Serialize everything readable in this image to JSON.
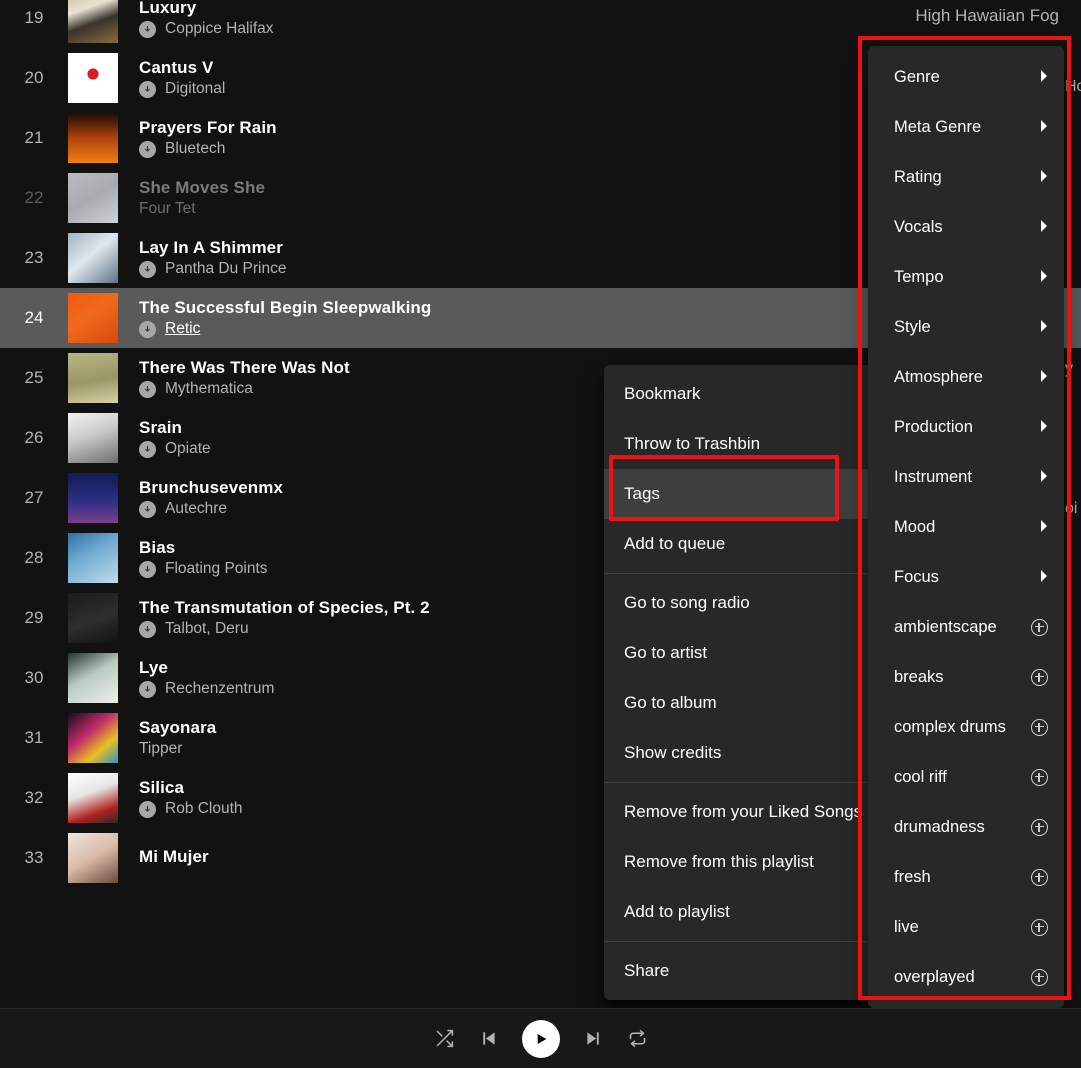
{
  "app": {
    "right_label": "High Hawaiian Fog",
    "edge_fragments": [
      "Ho",
      "y",
      "oi"
    ]
  },
  "tracklist": {
    "rows": [
      {
        "index": "19",
        "title": "Luxury",
        "artist": "Coppice Halifax",
        "downloaded": true,
        "dimmed": false,
        "art": "linear-gradient(160deg,#cbbfa8 0%,#e8e2d4 32%,#3a332a 58%,#8a6a41 100%)"
      },
      {
        "index": "20",
        "title": "Cantus V",
        "artist": "Digitonal",
        "downloaded": true,
        "dimmed": false,
        "art": "radial-gradient(circle at 50% 42%, #d81f26 0 14%, #ffffff 15% 100%)"
      },
      {
        "index": "21",
        "title": "Prayers For Rain",
        "artist": "Bluetech",
        "downloaded": true,
        "dimmed": false,
        "art": "linear-gradient(180deg,#1d0c05 0%,#b3450c 52%,#f07e14 100%)"
      },
      {
        "index": "22",
        "title": "She Moves She",
        "artist": "Four Tet",
        "downloaded": false,
        "dimmed": true,
        "art": "linear-gradient(150deg,#b9bcc0 0%,#a7aaae 50%,#cfd2d6 100%)"
      },
      {
        "index": "23",
        "title": "Lay In A Shimmer",
        "artist": "Pantha Du Prince",
        "downloaded": true,
        "dimmed": false,
        "art": "linear-gradient(140deg,#9fb4c4 0%,#dfe7ee 45%,#5d7487 100%)"
      },
      {
        "index": "24",
        "title": "The Successful Begin Sleepwalking",
        "artist": "Retic",
        "downloaded": true,
        "dimmed": false,
        "selected": true,
        "art": "linear-gradient(145deg,#f25a10 0%,#ef6a1d 45%,#d8490a 100%)"
      },
      {
        "index": "25",
        "title": "There Was There Was Not",
        "artist": "Mythematica",
        "downloaded": true,
        "dimmed": false,
        "art": "linear-gradient(170deg,#b9b684 0%,#9a9668 55%,#d7d2a6 100%)"
      },
      {
        "index": "26",
        "title": "Srain",
        "artist": "Opiate",
        "downloaded": true,
        "dimmed": false,
        "art": "linear-gradient(160deg,#f2f2f2 0%,#c9c9c9 45%,#6d6d6d 100%)"
      },
      {
        "index": "27",
        "title": "Brunchusevenmx",
        "artist": "Autechre",
        "downloaded": true,
        "dimmed": false,
        "art": "linear-gradient(180deg,#141a52 0%,#2b2f86 55%,#7a3f8c 100%)"
      },
      {
        "index": "28",
        "title": "Bias",
        "artist": "Floating Points",
        "downloaded": true,
        "dimmed": false,
        "art": "linear-gradient(150deg,#2f6fa8 0%,#6fa8cf 40%,#bfdcee 100%)"
      },
      {
        "index": "29",
        "title": "The Transmutation of Species, Pt. 2",
        "artist": "Talbot, Deru",
        "downloaded": true,
        "dimmed": false,
        "art": "linear-gradient(160deg,#1b1b1b 0%,#2e2e2e 55%,#111111 100%)"
      },
      {
        "index": "30",
        "title": "Lye",
        "artist": "Rechenzentrum",
        "downloaded": true,
        "dimmed": false,
        "art": "linear-gradient(150deg,#22332c 0%,#b9cbc0 45%,#f0f0ec 100%)"
      },
      {
        "index": "31",
        "title": "Sayonara",
        "artist": "Tipper",
        "downloaded": false,
        "dimmed": false,
        "art": "linear-gradient(140deg,#120f1a 0%,#c02a6a 40%,#e8c020 70%,#2f8fd0 100%)"
      },
      {
        "index": "32",
        "title": "Silica",
        "artist": "Rob Clouth",
        "downloaded": true,
        "dimmed": false,
        "art": "linear-gradient(160deg,#ffffff 0%,#e6e6e6 40%,#b02020 75%,#2a2a2a 100%)"
      },
      {
        "index": "33",
        "title": "Mi Mujer",
        "artist": "",
        "downloaded": false,
        "dimmed": false,
        "art": "linear-gradient(150deg,#efe6e0 0%,#d9b9a6 50%,#6a4a3a 100%)"
      }
    ]
  },
  "context_menu": {
    "items": [
      {
        "label": "Bookmark",
        "icon": "bookmark-icon"
      },
      {
        "label": "Throw to Trashbin"
      },
      {
        "label": "Tags",
        "highlighted": true,
        "submenu": true
      },
      {
        "label": "Add to queue"
      },
      {
        "separator_after": true
      },
      {
        "label": "Go to song radio"
      },
      {
        "label": "Go to artist"
      },
      {
        "label": "Go to album"
      },
      {
        "label": "Show credits"
      },
      {
        "separator_after": true
      },
      {
        "label": "Remove from your Liked Songs"
      },
      {
        "label": "Remove from this playlist"
      },
      {
        "label": "Add to playlist",
        "submenu": true
      },
      {
        "separator_after": true
      },
      {
        "label": "Share",
        "submenu": true
      }
    ]
  },
  "submenu": {
    "items": [
      {
        "label": "Genre",
        "type": "submenu"
      },
      {
        "label": "Meta Genre",
        "type": "submenu"
      },
      {
        "label": "Rating",
        "type": "submenu"
      },
      {
        "label": "Vocals",
        "type": "submenu"
      },
      {
        "label": "Tempo",
        "type": "submenu"
      },
      {
        "label": "Style",
        "type": "submenu"
      },
      {
        "label": "Atmosphere",
        "type": "submenu"
      },
      {
        "label": "Production",
        "type": "submenu"
      },
      {
        "label": "Instrument",
        "type": "submenu"
      },
      {
        "label": "Mood",
        "type": "submenu"
      },
      {
        "label": "Focus",
        "type": "submenu"
      },
      {
        "label": "ambientscape",
        "type": "add"
      },
      {
        "label": "breaks",
        "type": "add"
      },
      {
        "label": "complex drums",
        "type": "add"
      },
      {
        "label": "cool riff",
        "type": "add"
      },
      {
        "label": "drumadness",
        "type": "add"
      },
      {
        "label": "fresh",
        "type": "add"
      },
      {
        "label": "live",
        "type": "add"
      },
      {
        "label": "overplayed",
        "type": "add"
      }
    ]
  },
  "player": {
    "controls": [
      {
        "name": "shuffle-icon"
      },
      {
        "name": "previous-icon"
      },
      {
        "name": "play-icon"
      },
      {
        "name": "next-icon"
      },
      {
        "name": "repeat-icon"
      }
    ]
  },
  "colors": {
    "accent_annotation": "#ee1111",
    "menu_bg": "#282828",
    "row_selected": "#5a5a5a",
    "page_bg": "#121212"
  }
}
